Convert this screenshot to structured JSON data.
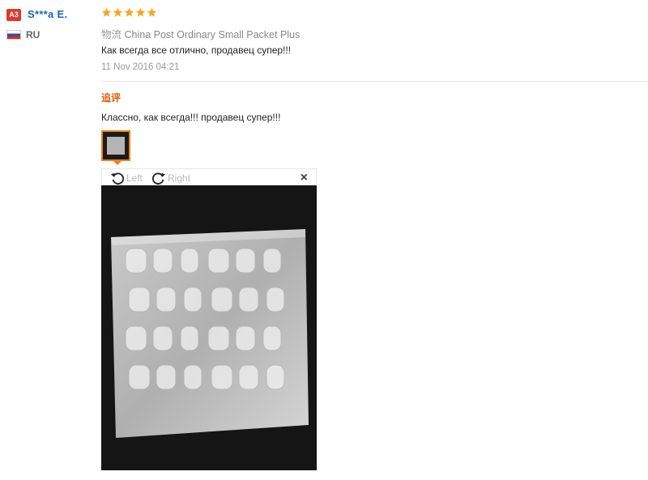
{
  "reviewer": {
    "level_badge": "A3",
    "name": "S***a E.",
    "country_code": "RU",
    "flag_icon": "russia-flag-icon"
  },
  "review": {
    "rating": 5,
    "star_color": "#f5a623",
    "shipping_label": "物流",
    "shipping_method": "China Post Ordinary Small Packet Plus",
    "text": "Как всегда все отлично, продавец супер!!!",
    "date": "11 Nov 2016 04:21"
  },
  "followup": {
    "label": "追评",
    "text": "Классно, как всегда!!! продавец супер!!!"
  },
  "viewer": {
    "rotate_left_label": "Left",
    "rotate_right_label": "Right",
    "close_glyph": "×",
    "icons": [
      "rotate-left-icon",
      "rotate-right-icon",
      "close-icon"
    ]
  },
  "colors": {
    "accent_orange": "#f07f1b",
    "name_blue": "#1a66b8",
    "badge_red": "#e0372a"
  }
}
